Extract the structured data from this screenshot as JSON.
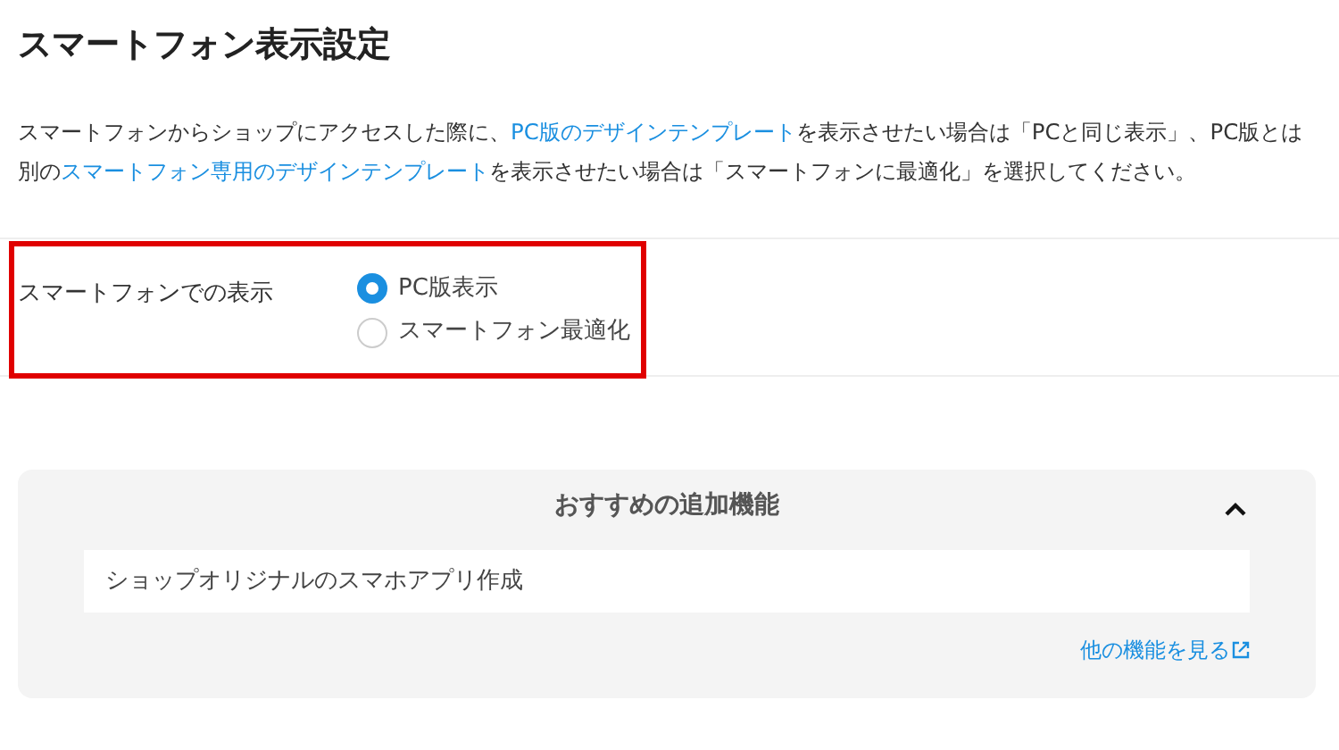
{
  "title": "スマートフォン表示設定",
  "description": [
    {
      "text": "スマートフォンからショップにアクセスした際に、",
      "link": false
    },
    {
      "text": "PC版のデザインテンプレート",
      "link": true
    },
    {
      "text": "を表示させたい場合は「PCと同じ表示」、PC版とは別の",
      "link": false
    },
    {
      "text": "スマートフォン専用のデザインテンプレート",
      "link": true
    },
    {
      "text": "を表示させたい場合は「スマートフォンに最適化」を選択してください。",
      "link": false
    }
  ],
  "setting": {
    "label": "スマートフォンでの表示",
    "highlighted": true,
    "options": [
      {
        "label": "PC版表示",
        "selected": true
      },
      {
        "label": "スマートフォン最適化",
        "selected": false
      }
    ]
  },
  "recommend": {
    "title": "おすすめの追加機能",
    "expanded": true,
    "items": [
      "ショップオリジナルのスマホアプリ作成"
    ],
    "more_link": "他の機能を見る"
  }
}
